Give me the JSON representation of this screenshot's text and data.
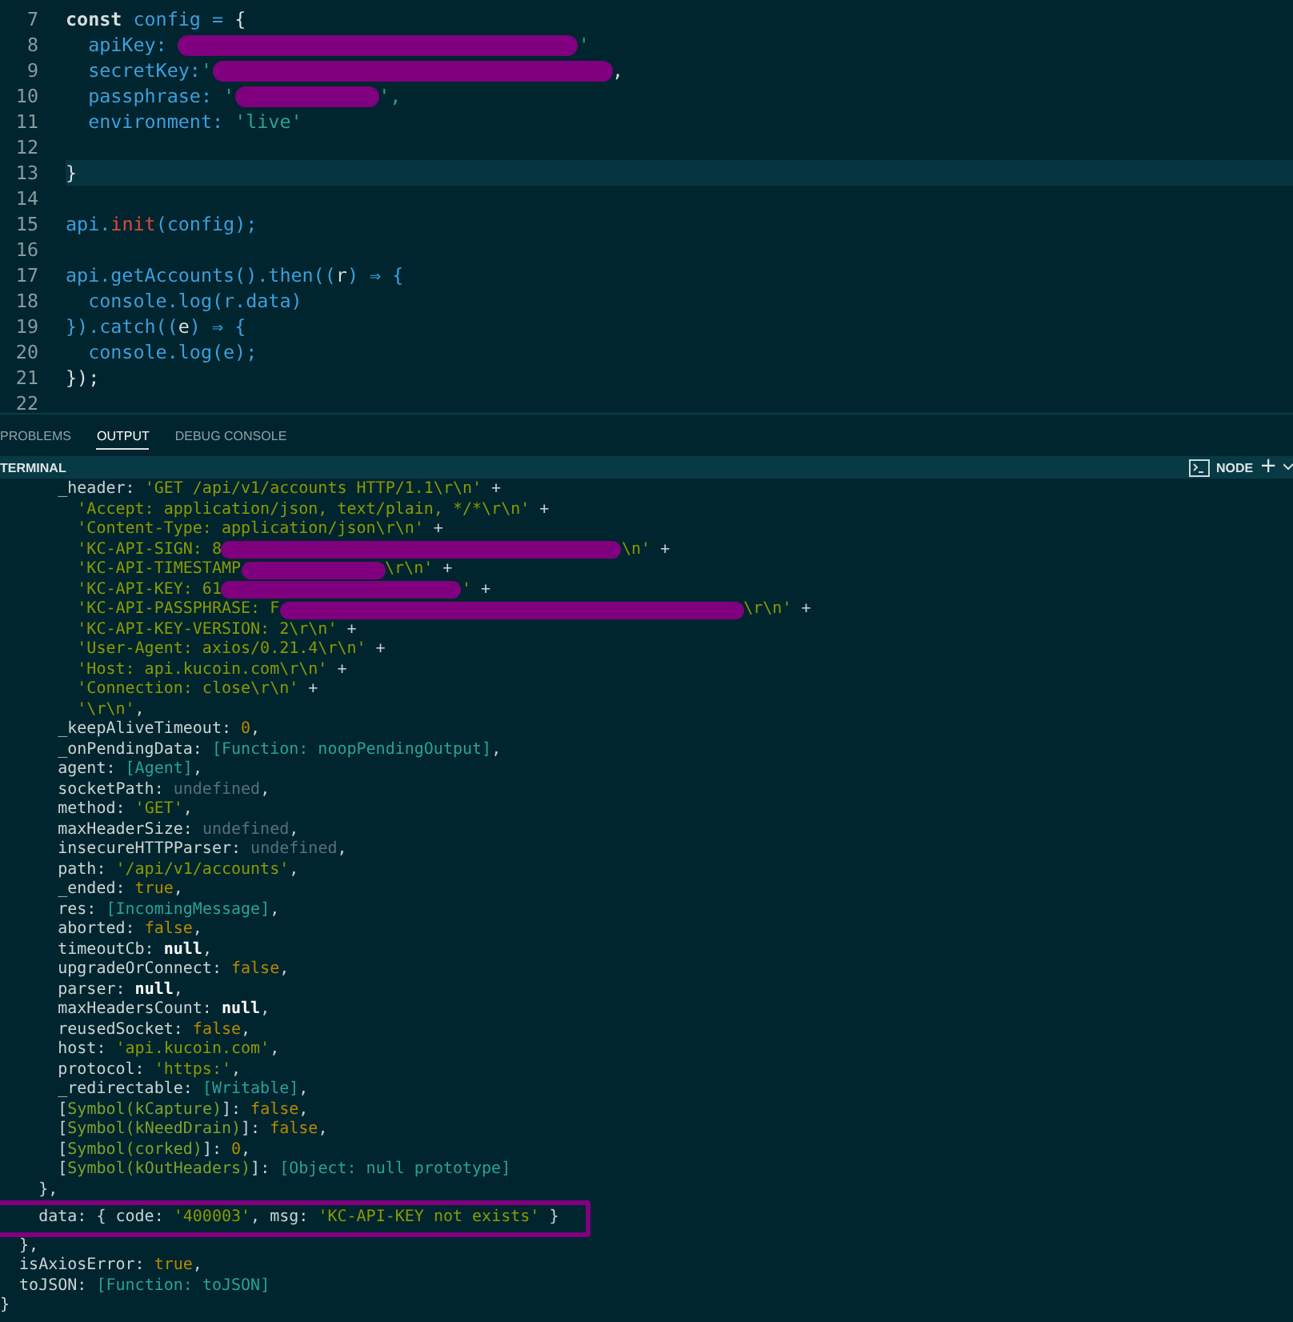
{
  "editor": {
    "lines": [
      {
        "number": "7",
        "current": false,
        "tokens": [
          {
            "text": "const",
            "kind": "keyword"
          },
          {
            "text": " config = ",
            "kind": "ident"
          },
          {
            "text": "{",
            "kind": "punct"
          }
        ]
      },
      {
        "number": "8",
        "current": false,
        "tokens": [
          {
            "text": "  apiKey: ",
            "kind": "ident"
          },
          {
            "kind": "redaction"
          },
          {
            "text": "'",
            "kind": "string"
          }
        ]
      },
      {
        "number": "9",
        "current": false,
        "tokens": [
          {
            "text": "  secretKey:",
            "kind": "ident"
          },
          {
            "text": "'",
            "kind": "string"
          },
          {
            "kind": "redaction"
          },
          {
            "text": ",",
            "kind": "punct"
          }
        ]
      },
      {
        "number": "10",
        "current": false,
        "tokens": [
          {
            "text": "  passphrase: ",
            "kind": "ident"
          },
          {
            "text": "'",
            "kind": "string"
          },
          {
            "kind": "redaction"
          },
          {
            "text": "',",
            "kind": "string"
          }
        ]
      },
      {
        "number": "11",
        "current": false,
        "tokens": [
          {
            "text": "  environment: ",
            "kind": "ident"
          },
          {
            "text": "'live'",
            "kind": "string"
          }
        ]
      },
      {
        "number": "12",
        "current": false
      },
      {
        "number": "13",
        "current": true,
        "tokens": [
          {
            "text": "}",
            "kind": "punct"
          }
        ]
      },
      {
        "number": "14",
        "current": false
      },
      {
        "number": "15",
        "current": false,
        "tokens": [
          {
            "text": "api.",
            "kind": "ident"
          },
          {
            "text": "init",
            "kind": "func"
          },
          {
            "text": "(config);",
            "kind": "ident"
          }
        ]
      },
      {
        "number": "16",
        "current": false
      },
      {
        "number": "17",
        "current": false,
        "tokens": [
          {
            "text": "api.getAccounts().then((",
            "kind": "ident"
          },
          {
            "text": "r",
            "kind": "punct"
          },
          {
            "text": ") ⇒ {",
            "kind": "ident"
          }
        ]
      },
      {
        "number": "18",
        "current": false,
        "tokens": [
          {
            "text": "  console.log(r.data)",
            "kind": "ident"
          }
        ]
      },
      {
        "number": "19",
        "current": false,
        "tokens": [
          {
            "text": "}).catch((",
            "kind": "ident"
          },
          {
            "text": "e",
            "kind": "punct"
          },
          {
            "text": ") ⇒ {",
            "kind": "ident"
          }
        ]
      },
      {
        "number": "20",
        "current": false,
        "tokens": [
          {
            "text": "  console.log(e);",
            "kind": "ident"
          }
        ]
      },
      {
        "number": "21",
        "current": false,
        "tokens": [
          {
            "text": "});",
            "kind": "punct"
          }
        ]
      },
      {
        "number": "22",
        "current": false
      }
    ]
  },
  "panel": {
    "tabs": [
      {
        "label": "PROBLEMS",
        "selected": false
      },
      {
        "label": "OUTPUT",
        "selected": true
      },
      {
        "label": "DEBUG CONSOLE",
        "selected": false
      }
    ],
    "terminal_title": "TERMINAL",
    "shell": "NODE",
    "add": "+"
  },
  "terminal": {
    "lines": [
      {
        "tokens": [
          {
            "text": "      _header: ",
            "kind": "plain"
          },
          {
            "text": "'GET /api/v1/accounts HTTP/1.1\\r\\n'",
            "kind": "string"
          },
          {
            "text": " +",
            "kind": "plain"
          }
        ]
      },
      {
        "tokens": [
          {
            "text": "        'Accept: application/json, text/plain, */*\\r\\n'",
            "kind": "string"
          },
          {
            "text": " +",
            "kind": "plain"
          }
        ]
      },
      {
        "tokens": [
          {
            "text": "        'Content-Type: application/json\\r\\n'",
            "kind": "string"
          },
          {
            "text": " +",
            "kind": "plain"
          }
        ]
      },
      {
        "tokens": [
          {
            "text": "        'KC-API-SIGN: 8",
            "kind": "string"
          },
          {
            "kind": "redaction"
          },
          {
            "text": "\\n'",
            "kind": "string"
          },
          {
            "text": " +",
            "kind": "plain"
          }
        ]
      },
      {
        "tokens": [
          {
            "text": "        'KC-API-TIMESTAMP",
            "kind": "string"
          },
          {
            "kind": "redaction"
          },
          {
            "text": "\\r\\n'",
            "kind": "string"
          },
          {
            "text": " +",
            "kind": "plain"
          }
        ]
      },
      {
        "tokens": [
          {
            "text": "        'KC-API-KEY: 61",
            "kind": "string"
          },
          {
            "kind": "redaction"
          },
          {
            "text": "'",
            "kind": "string"
          },
          {
            "text": " +",
            "kind": "plain"
          }
        ]
      },
      {
        "tokens": [
          {
            "text": "        'KC-API-PASSPHRASE: F",
            "kind": "string"
          },
          {
            "kind": "redaction"
          },
          {
            "text": "\\r\\n'",
            "kind": "string"
          },
          {
            "text": " +",
            "kind": "plain"
          }
        ]
      },
      {
        "tokens": [
          {
            "text": "        'KC-API-KEY-VERSION: 2\\r\\n'",
            "kind": "string"
          },
          {
            "text": " +",
            "kind": "plain"
          }
        ]
      },
      {
        "tokens": [
          {
            "text": "        'User-Agent: axios/0.21.4\\r\\n'",
            "kind": "string"
          },
          {
            "text": " +",
            "kind": "plain"
          }
        ]
      },
      {
        "tokens": [
          {
            "text": "        'Host: api.kucoin.com\\r\\n'",
            "kind": "string"
          },
          {
            "text": " +",
            "kind": "plain"
          }
        ]
      },
      {
        "tokens": [
          {
            "text": "        'Connection: close\\r\\n'",
            "kind": "string"
          },
          {
            "text": " +",
            "kind": "plain"
          }
        ]
      },
      {
        "tokens": [
          {
            "text": "        '\\r\\n'",
            "kind": "string"
          },
          {
            "text": ",",
            "kind": "plain"
          }
        ]
      },
      {
        "tokens": [
          {
            "text": "      _keepAliveTimeout: ",
            "kind": "plain"
          },
          {
            "text": "0",
            "kind": "number"
          },
          {
            "text": ",",
            "kind": "plain"
          }
        ]
      },
      {
        "tokens": [
          {
            "text": "      _onPendingData: ",
            "kind": "plain"
          },
          {
            "text": "[Function: noopPendingOutput]",
            "kind": "special"
          },
          {
            "text": ",",
            "kind": "plain"
          }
        ]
      },
      {
        "tokens": [
          {
            "text": "      agent: ",
            "kind": "plain"
          },
          {
            "text": "[Agent]",
            "kind": "special"
          },
          {
            "text": ",",
            "kind": "plain"
          }
        ]
      },
      {
        "tokens": [
          {
            "text": "      socketPath: ",
            "kind": "plain"
          },
          {
            "text": "undefined",
            "kind": "undef"
          },
          {
            "text": ",",
            "kind": "plain"
          }
        ]
      },
      {
        "tokens": [
          {
            "text": "      method: ",
            "kind": "plain"
          },
          {
            "text": "'GET'",
            "kind": "string"
          },
          {
            "text": ",",
            "kind": "plain"
          }
        ]
      },
      {
        "tokens": [
          {
            "text": "      maxHeaderSize: ",
            "kind": "plain"
          },
          {
            "text": "undefined",
            "kind": "undef"
          },
          {
            "text": ",",
            "kind": "plain"
          }
        ]
      },
      {
        "tokens": [
          {
            "text": "      insecureHTTPParser: ",
            "kind": "plain"
          },
          {
            "text": "undefined",
            "kind": "undef"
          },
          {
            "text": ",",
            "kind": "plain"
          }
        ]
      },
      {
        "tokens": [
          {
            "text": "      path: ",
            "kind": "plain"
          },
          {
            "text": "'/api/v1/accounts'",
            "kind": "string"
          },
          {
            "text": ",",
            "kind": "plain"
          }
        ]
      },
      {
        "tokens": [
          {
            "text": "      _ended: ",
            "kind": "plain"
          },
          {
            "text": "true",
            "kind": "number"
          },
          {
            "text": ",",
            "kind": "plain"
          }
        ]
      },
      {
        "tokens": [
          {
            "text": "      res: ",
            "kind": "plain"
          },
          {
            "text": "[IncomingMessage]",
            "kind": "special"
          },
          {
            "text": ",",
            "kind": "plain"
          }
        ]
      },
      {
        "tokens": [
          {
            "text": "      aborted: ",
            "kind": "plain"
          },
          {
            "text": "false",
            "kind": "number"
          },
          {
            "text": ",",
            "kind": "plain"
          }
        ]
      },
      {
        "tokens": [
          {
            "text": "      timeoutCb: ",
            "kind": "plain"
          },
          {
            "text": "null",
            "kind": "null"
          },
          {
            "text": ",",
            "kind": "plain"
          }
        ]
      },
      {
        "tokens": [
          {
            "text": "      upgradeOrConnect: ",
            "kind": "plain"
          },
          {
            "text": "false",
            "kind": "number"
          },
          {
            "text": ",",
            "kind": "plain"
          }
        ]
      },
      {
        "tokens": [
          {
            "text": "      parser: ",
            "kind": "plain"
          },
          {
            "text": "null",
            "kind": "null"
          },
          {
            "text": ",",
            "kind": "plain"
          }
        ]
      },
      {
        "tokens": [
          {
            "text": "      maxHeadersCount: ",
            "kind": "plain"
          },
          {
            "text": "null",
            "kind": "null"
          },
          {
            "text": ",",
            "kind": "plain"
          }
        ]
      },
      {
        "tokens": [
          {
            "text": "      reusedSocket: ",
            "kind": "plain"
          },
          {
            "text": "false",
            "kind": "number"
          },
          {
            "text": ",",
            "kind": "plain"
          }
        ]
      },
      {
        "tokens": [
          {
            "text": "      host: ",
            "kind": "plain"
          },
          {
            "text": "'api.kucoin.com'",
            "kind": "string"
          },
          {
            "text": ",",
            "kind": "plain"
          }
        ]
      },
      {
        "tokens": [
          {
            "text": "      protocol: ",
            "kind": "plain"
          },
          {
            "text": "'https:'",
            "kind": "string"
          },
          {
            "text": ",",
            "kind": "plain"
          }
        ]
      },
      {
        "tokens": [
          {
            "text": "      _redirectable: ",
            "kind": "plain"
          },
          {
            "text": "[Writable]",
            "kind": "special"
          },
          {
            "text": ",",
            "kind": "plain"
          }
        ]
      },
      {
        "tokens": [
          {
            "text": "      [",
            "kind": "plain"
          },
          {
            "text": "Symbol(kCapture)",
            "kind": "symbol"
          },
          {
            "text": "]: ",
            "kind": "plain"
          },
          {
            "text": "false",
            "kind": "number"
          },
          {
            "text": ",",
            "kind": "plain"
          }
        ]
      },
      {
        "tokens": [
          {
            "text": "      [",
            "kind": "plain"
          },
          {
            "text": "Symbol(kNeedDrain)",
            "kind": "symbol"
          },
          {
            "text": "]: ",
            "kind": "plain"
          },
          {
            "text": "false",
            "kind": "number"
          },
          {
            "text": ",",
            "kind": "plain"
          }
        ]
      },
      {
        "tokens": [
          {
            "text": "      [",
            "kind": "plain"
          },
          {
            "text": "Symbol(corked)",
            "kind": "symbol"
          },
          {
            "text": "]: ",
            "kind": "plain"
          },
          {
            "text": "0",
            "kind": "number"
          },
          {
            "text": ",",
            "kind": "plain"
          }
        ]
      },
      {
        "tokens": [
          {
            "text": "      [",
            "kind": "plain"
          },
          {
            "text": "Symbol(kOutHeaders)",
            "kind": "symbol"
          },
          {
            "text": "]: ",
            "kind": "plain"
          },
          {
            "text": "[Object: null prototype]",
            "kind": "special"
          }
        ]
      },
      {
        "tokens": [
          {
            "text": "    },",
            "kind": "plain"
          }
        ]
      },
      {
        "highlighted": true,
        "tokens": [
          {
            "text": "    data: { code: ",
            "kind": "plain"
          },
          {
            "text": "'400003'",
            "kind": "string"
          },
          {
            "text": ", msg: ",
            "kind": "plain"
          },
          {
            "text": "'KC-API-KEY not exists'",
            "kind": "string"
          },
          {
            "text": " }",
            "kind": "plain"
          }
        ]
      },
      {
        "tokens": [
          {
            "text": "  },",
            "kind": "plain"
          }
        ]
      },
      {
        "tokens": [
          {
            "text": "  isAxiosError: ",
            "kind": "plain"
          },
          {
            "text": "true",
            "kind": "number"
          },
          {
            "text": ",",
            "kind": "plain"
          }
        ]
      },
      {
        "tokens": [
          {
            "text": "  toJSON: ",
            "kind": "plain"
          },
          {
            "text": "[Function: toJSON]",
            "kind": "special"
          }
        ]
      },
      {
        "tokens": [
          {
            "text": "}",
            "kind": "plain"
          }
        ]
      }
    ]
  }
}
